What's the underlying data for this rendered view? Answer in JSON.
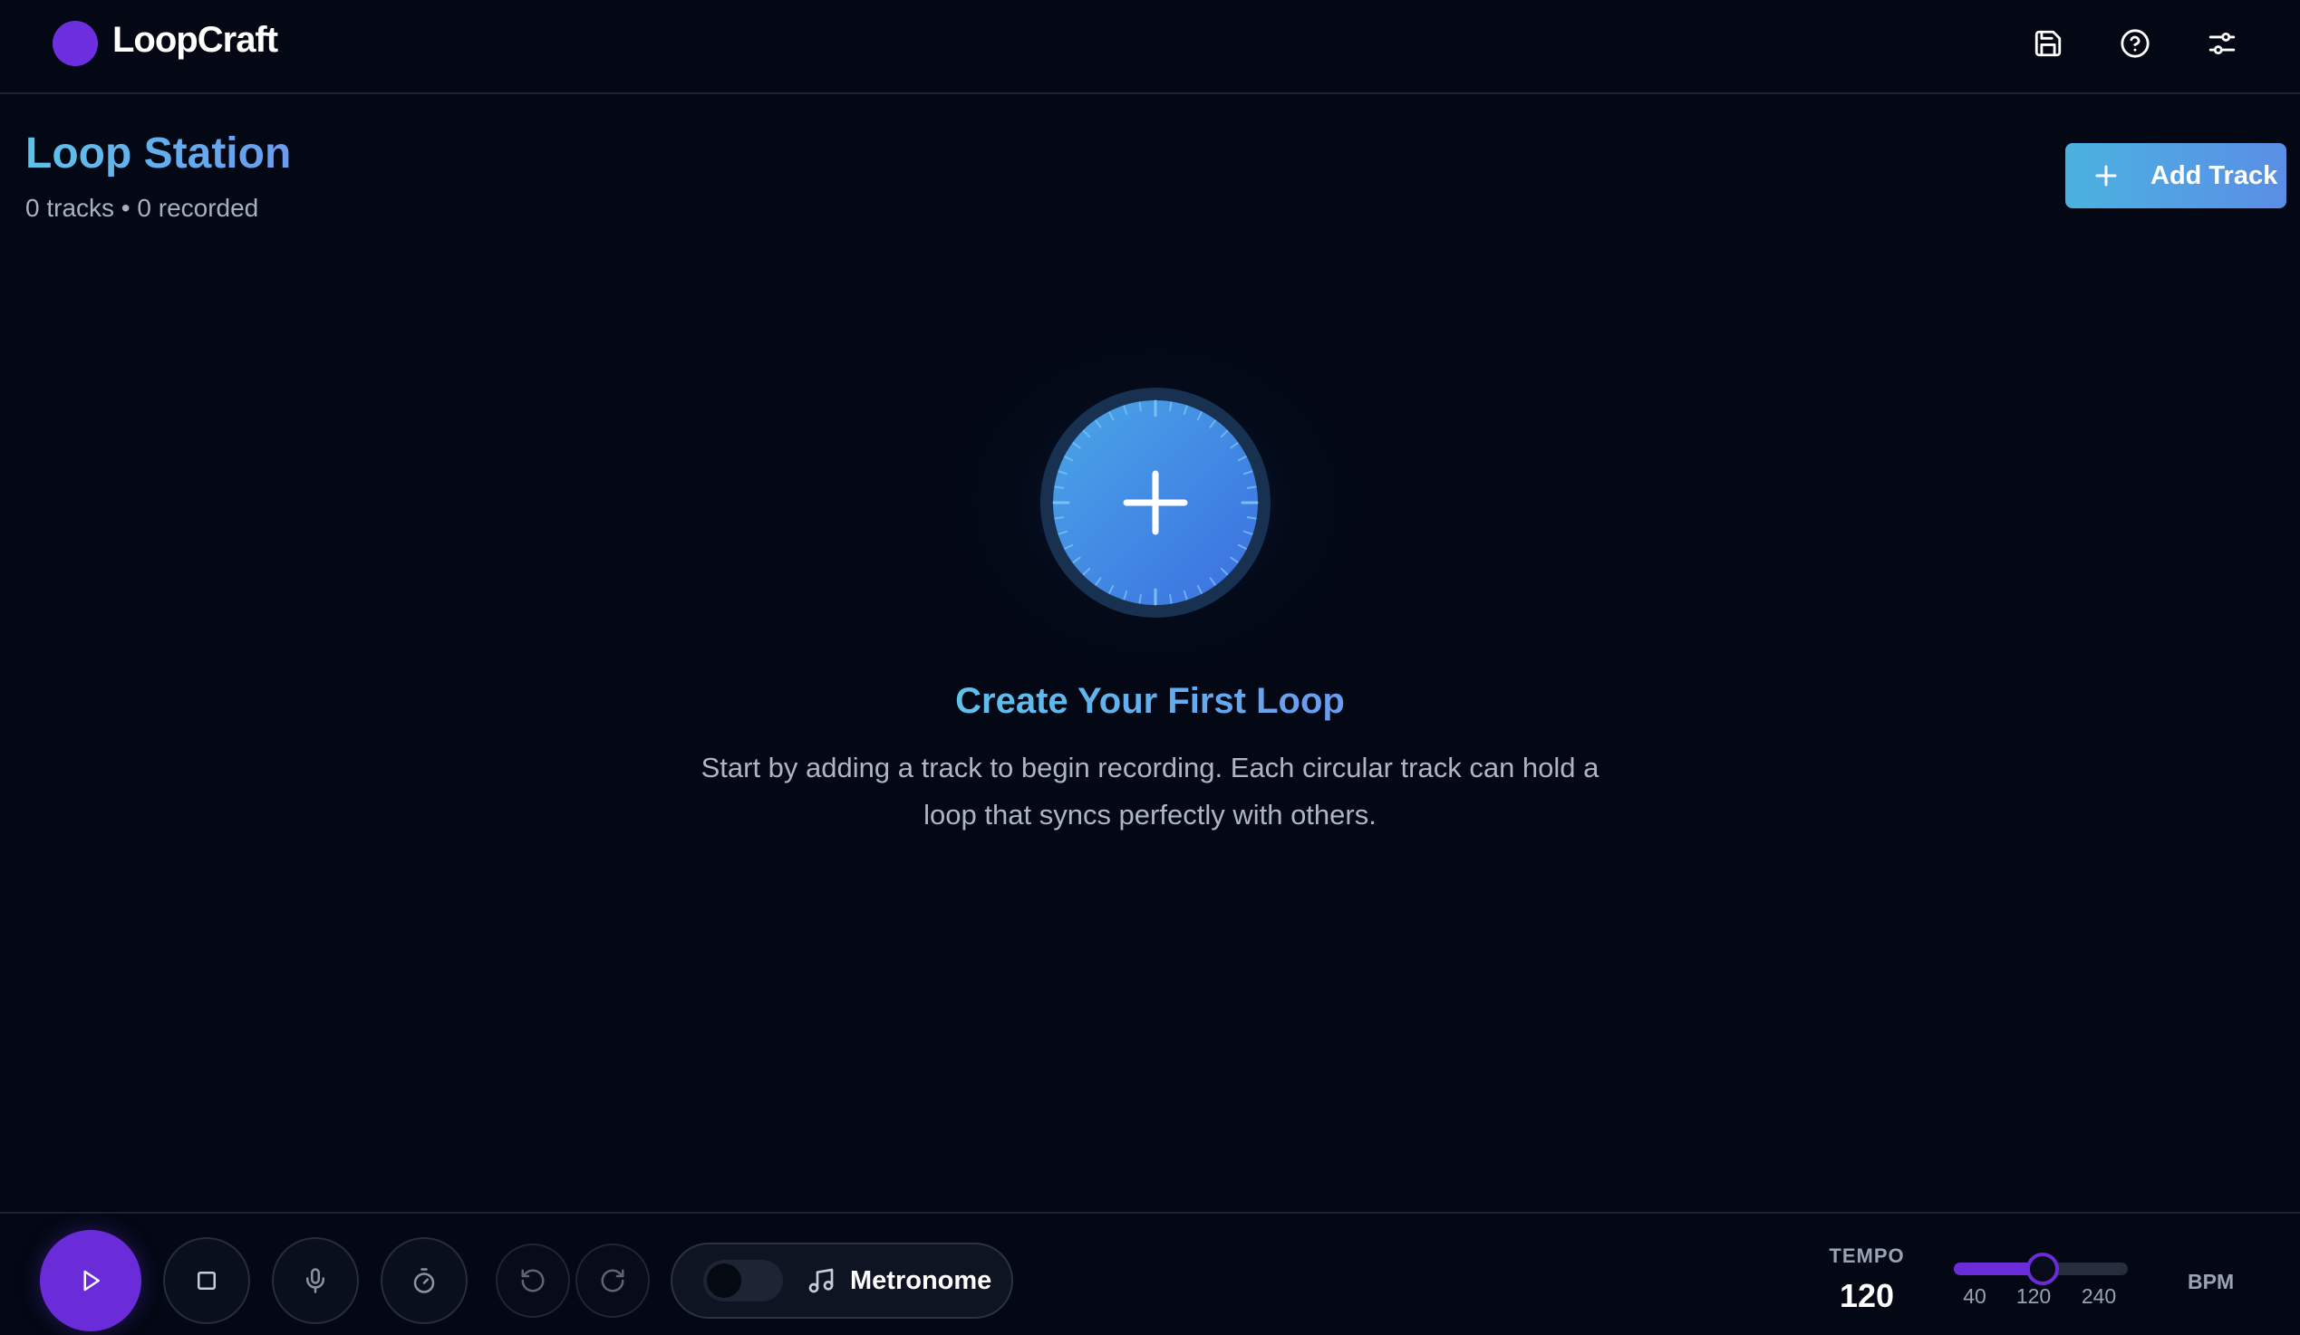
{
  "app": {
    "name": "LoopCraft"
  },
  "header": {
    "icons": [
      "save-icon",
      "help-icon",
      "settings-sliders-icon"
    ]
  },
  "page": {
    "title": "Loop Station",
    "subtitle": "0 tracks • 0 recorded",
    "add_track_label": "Add Track"
  },
  "empty_state": {
    "title": "Create Your First Loop",
    "description": "Start by adding a track to begin recording. Each circular track can hold a loop that syncs perfectly with others."
  },
  "transport": {
    "icons": [
      "play-icon",
      "stop-icon",
      "microphone-icon",
      "timer-icon",
      "undo-icon",
      "redo-icon"
    ],
    "metronome_label": "Metronome",
    "metronome_on": false
  },
  "tempo": {
    "label": "TEMPO",
    "value": "120",
    "min": 40,
    "max": 240,
    "current": 120,
    "tick_min": "40",
    "tick_mid": "120",
    "tick_max": "240",
    "unit": "BPM"
  },
  "colors": {
    "background": "#030814",
    "accent_purple": "#6a2cd8",
    "accent_blue": "#5a8ee6",
    "accent_cyan": "#4bb2e0"
  }
}
